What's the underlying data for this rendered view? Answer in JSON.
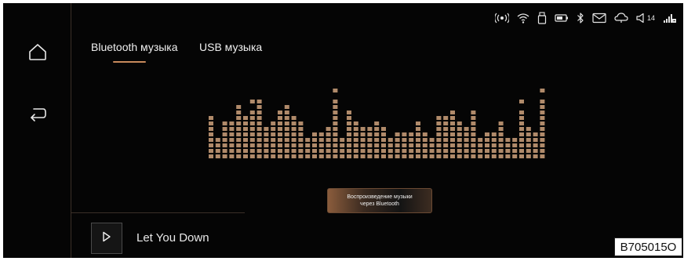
{
  "status_bar": {
    "icons": [
      "wifi-hotspot-icon",
      "wifi-icon",
      "usb-icon",
      "battery-icon",
      "bluetooth-icon",
      "mail-icon",
      "cloud-icon",
      "volume-icon",
      "signal-icon"
    ],
    "volume_level": "14"
  },
  "navigation": {
    "items": [
      {
        "name": "home",
        "icon": "home-icon"
      },
      {
        "name": "back",
        "icon": "back-icon"
      }
    ]
  },
  "tabs": [
    {
      "label": "Bluetooth музыка",
      "active": true
    },
    {
      "label": "USB музыка",
      "active": false
    }
  ],
  "colors": {
    "accent": "#c88a5c",
    "equalizer": "#b08a6a",
    "background": "#050505"
  },
  "visualizer": {
    "levels": [
      4,
      0,
      3,
      3,
      6,
      4,
      5,
      7,
      2,
      3,
      5,
      6,
      4,
      3,
      0,
      1,
      1,
      2,
      7,
      0,
      5,
      3,
      2,
      2,
      3,
      2,
      0,
      1,
      1,
      1,
      3,
      1,
      0,
      4,
      4,
      5,
      3,
      2,
      5,
      0,
      1,
      1,
      3,
      0,
      0,
      5,
      2,
      1,
      7
    ]
  },
  "caption_button": {
    "line1": "Воспроизведение музыки",
    "line2": "через Bluetooth"
  },
  "now_playing": {
    "title": "Let You Down",
    "play_icon": "play-icon"
  },
  "figure_code": "B705015O"
}
